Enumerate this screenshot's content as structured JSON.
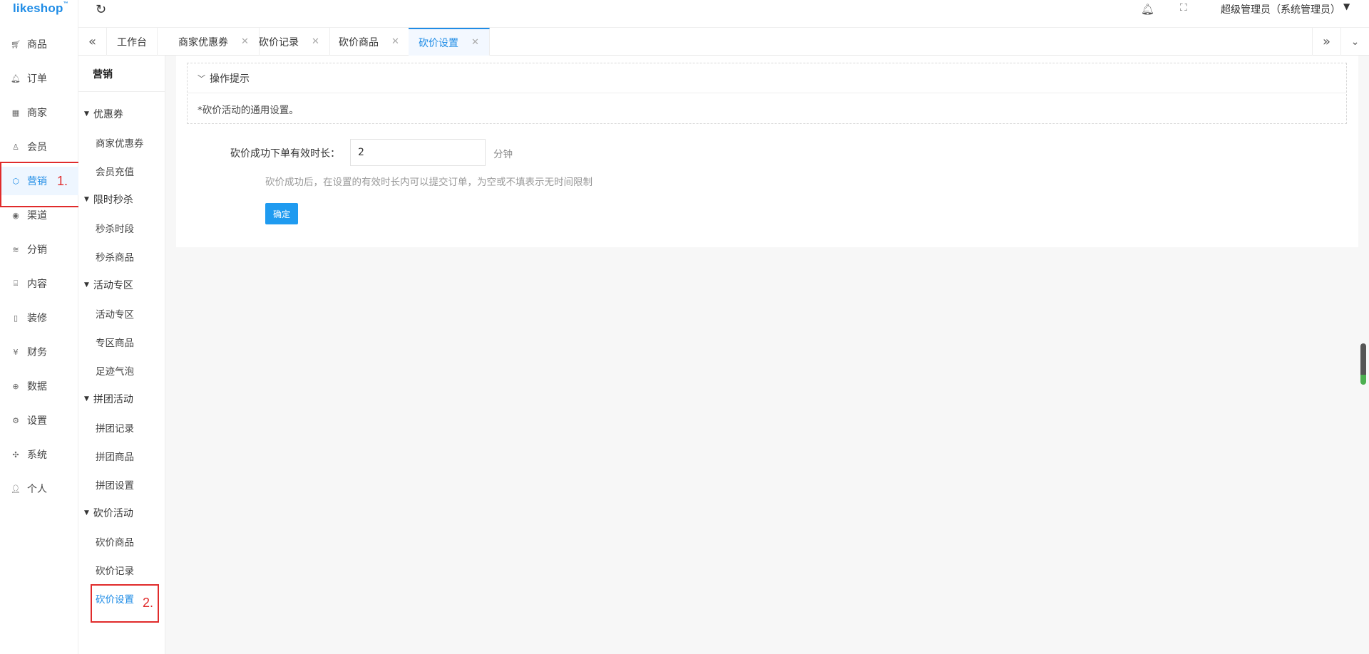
{
  "app": {
    "logo_text": "likeshop",
    "logo_mark": "™"
  },
  "main_nav": [
    {
      "label": "商品",
      "icon": "cart-icon"
    },
    {
      "label": "订单",
      "icon": "bell-icon"
    },
    {
      "label": "商家",
      "icon": "store-icon"
    },
    {
      "label": "会员",
      "icon": "user-icon"
    },
    {
      "label": "营销",
      "icon": "box-icon",
      "active": true
    },
    {
      "label": "渠道",
      "icon": "channel-icon"
    },
    {
      "label": "分销",
      "icon": "layers-icon"
    },
    {
      "label": "内容",
      "icon": "book-icon"
    },
    {
      "label": "装修",
      "icon": "tablet-icon"
    },
    {
      "label": "财务",
      "icon": "yen-icon"
    },
    {
      "label": "数据",
      "icon": "globe-icon"
    },
    {
      "label": "设置",
      "icon": "gear-icon"
    },
    {
      "label": "系统",
      "icon": "system-icon"
    },
    {
      "label": "个人",
      "icon": "person-icon"
    }
  ],
  "annotations": {
    "step1": "1.",
    "step2": "2."
  },
  "header": {
    "user_name": "超级管理员（系统管理员）"
  },
  "tabs": [
    {
      "label": "工作台",
      "closable": false
    },
    {
      "label": "商家优惠券",
      "closable": true
    },
    {
      "label": "砍价记录",
      "closable": true
    },
    {
      "label": "砍价商品",
      "closable": true
    },
    {
      "label": "砍价设置",
      "closable": true,
      "active": true
    }
  ],
  "sub_nav": {
    "title": "营销",
    "groups": [
      {
        "label": "优惠券",
        "items": [
          "商家优惠券",
          "会员充值"
        ]
      },
      {
        "label": "限时秒杀",
        "items": [
          "秒杀时段",
          "秒杀商品"
        ]
      },
      {
        "label": "活动专区",
        "items": [
          "活动专区",
          "专区商品",
          "足迹气泡"
        ]
      },
      {
        "label": "拼团活动",
        "items": [
          "拼团记录",
          "拼团商品",
          "拼团设置"
        ]
      },
      {
        "label": "砍价活动",
        "items": [
          "砍价商品",
          "砍价记录",
          "砍价设置"
        ]
      }
    ],
    "active_item": "砍价设置"
  },
  "content": {
    "tips_title": "操作提示",
    "tips_text": "*砍价活动的通用设置。",
    "form_label": "砍价成功下单有效时长：",
    "duration_value": "2",
    "unit": "分钟",
    "help_text": "砍价成功后，在设置的有效时长内可以提交订单，为空或不填表示无时间限制",
    "confirm_label": "确定"
  }
}
